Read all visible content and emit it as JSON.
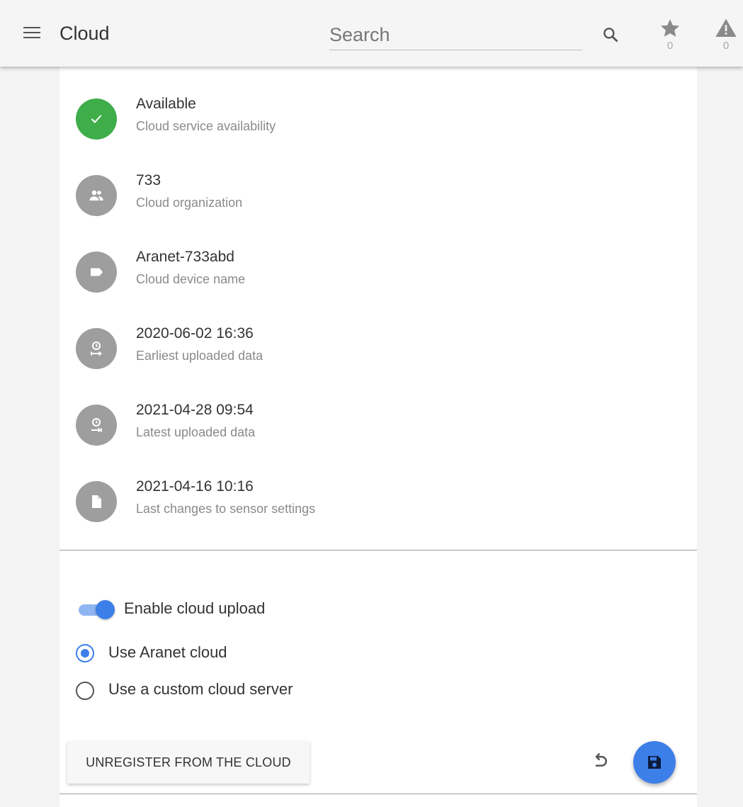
{
  "header": {
    "title": "Cloud",
    "search_placeholder": "Search",
    "favorites_count": "0",
    "alerts_count": "0"
  },
  "info": [
    {
      "icon": "check-icon",
      "value": "Available",
      "label": "Cloud service availability"
    },
    {
      "icon": "people-icon",
      "value": "733",
      "label": "Cloud organization"
    },
    {
      "icon": "tag-icon",
      "value": "Aranet-733abd",
      "label": "Cloud device name"
    },
    {
      "icon": "clock-start-icon",
      "value": "2020-06-02 16:36",
      "label": "Earliest uploaded data"
    },
    {
      "icon": "clock-end-icon",
      "value": "2021-04-28 09:54",
      "label": "Latest uploaded data"
    },
    {
      "icon": "file-icon",
      "value": "2021-04-16 10:16",
      "label": "Last changes to sensor settings"
    }
  ],
  "settings": {
    "enable_upload_label": "Enable cloud upload",
    "enable_upload_on": true,
    "options": [
      {
        "label": "Use Aranet cloud",
        "selected": true
      },
      {
        "label": "Use a custom cloud server",
        "selected": false
      }
    ]
  },
  "actions": {
    "unregister_label": "UNREGISTER FROM THE CLOUD"
  },
  "colors": {
    "accent": "#3d7fe8",
    "ok": "#3fae4a",
    "icon_circle": "#9e9e9e"
  }
}
